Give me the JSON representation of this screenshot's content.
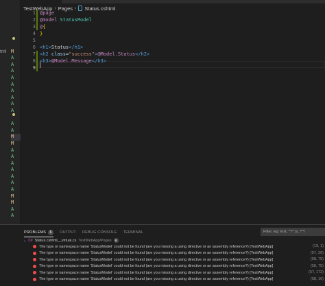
{
  "explorer": {
    "partial_filename": "tml",
    "status_letters": [
      "",
      "M",
      "A",
      "A",
      "A",
      "A",
      "A",
      "A",
      "A",
      "A",
      "A",
      "",
      "A",
      "A",
      "M",
      "M",
      "A",
      "A",
      "A",
      "A",
      "A",
      "A",
      "A",
      "M",
      "M",
      "A",
      "A"
    ]
  },
  "breadcrumb": {
    "project": "TestWebApp",
    "folder": "Pages",
    "file": "Status.cshtml"
  },
  "editor": {
    "line_numbers": [
      "1",
      "2",
      "3",
      "4",
      "5",
      "6",
      "7",
      "8",
      "9"
    ],
    "lines": {
      "l1": "@page",
      "l2_kw": "@model",
      "l2_type": "StatusModel",
      "l3_kw": "@",
      "l3_brace": "{",
      "l4_brace": "}",
      "l6_open": "<h1>",
      "l6_text": "Status",
      "l6_close": "</h1>",
      "l7_open_tag": "<h2 ",
      "l7_attr": "class",
      "l7_eq": "=",
      "l7_val": "\"success\"",
      "l7_gt": ">",
      "l7_model": "@Model.Status",
      "l7_close": "</h2>",
      "l8_open": "<h3>",
      "l8_model": "@Model.Message",
      "l8_close": "</h3>"
    }
  },
  "panel": {
    "tabs": {
      "problems": "PROBLEMS",
      "problems_count": "6",
      "output": "OUTPUT",
      "debug_console": "DEBUG CONSOLE",
      "terminal": "TERMINAL"
    },
    "filter_placeholder": "Filter. Eg: text, **/*.ts, !**/",
    "group": {
      "icon_text": "C#",
      "file": "Status.cshtml__virtual.cs",
      "path": "TestWebApp/Pages",
      "count": "6"
    },
    "problems": [
      {
        "message": "The type or namespace name 'StatusModel' could not be found (are you missing a using directive or an assembly reference?) [TestWebApp]",
        "location": "(19, 1)"
      },
      {
        "message": "The type or namespace name 'StatusModel' could not be found (are you missing a using directive or an assembly reference?) [TestWebApp]",
        "location": "(57, 36)"
      },
      {
        "message": "The type or namespace name 'StatusModel' could not be found (are you missing a using directive or an assembly reference?) [TestWebApp]",
        "location": "(58, 75)"
      },
      {
        "message": "The type or namespace name 'StatusModel' could not be found (are you missing a using directive or an assembly reference?) [TestWebApp]",
        "location": "(58, 75)"
      },
      {
        "message": "The type or namespace name 'StatusModel' could not be found (are you missing a using directive or an assembly reference?) [TestWebApp]",
        "location": "(57, 172)"
      },
      {
        "message": "The type or namespace name 'StatusModel' could not be found (are you missing a using directive or an assembly reference?) [TestWebApp]",
        "location": "(58, 16)"
      }
    ]
  },
  "colors": {
    "error": "#f14c4c",
    "added": "#73c991",
    "modified": "#e2c08d",
    "editor_bg": "#1e1e1e"
  }
}
